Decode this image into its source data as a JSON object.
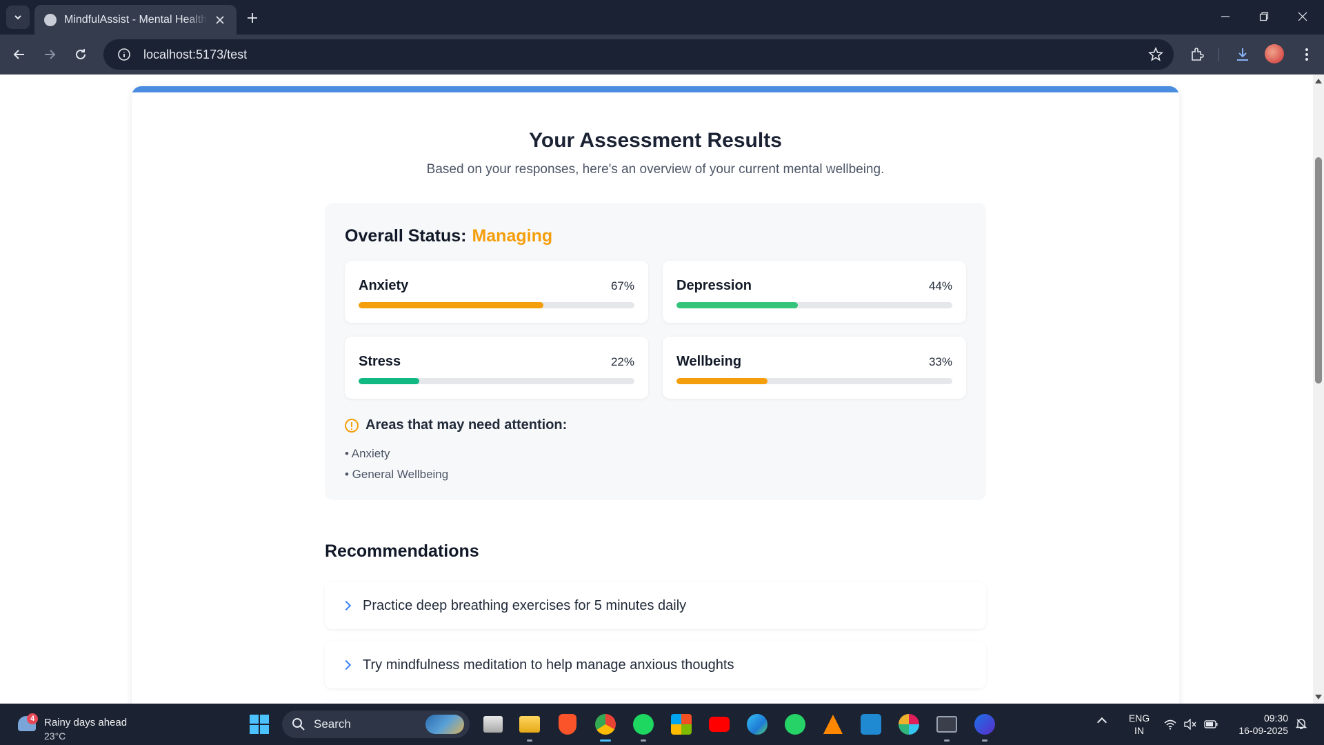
{
  "browser": {
    "tab_title": "MindfulAssist - Mental Health Assistant",
    "url": "localhost:5173/test"
  },
  "page": {
    "title": "Your Assessment Results",
    "subtitle": "Based on your responses, here's an overview of your current mental wellbeing.",
    "status": {
      "label": "Overall Status:",
      "value": "Managing",
      "value_color": "#f59e0b"
    },
    "metrics": [
      {
        "name": "Anxiety",
        "percent_label": "67%",
        "percent": 67,
        "color": "#f59e0b"
      },
      {
        "name": "Depression",
        "percent_label": "44%",
        "percent": 44,
        "color": "#34c47a"
      },
      {
        "name": "Stress",
        "percent_label": "22%",
        "percent": 22,
        "color": "#10b981"
      },
      {
        "name": "Wellbeing",
        "percent_label": "33%",
        "percent": 33,
        "color": "#f59e0b"
      }
    ],
    "attention": {
      "title": "Areas that may need attention:",
      "items": [
        "• Anxiety",
        "• General Wellbeing"
      ]
    },
    "recommendations": {
      "title": "Recommendations",
      "items": [
        "Practice deep breathing exercises for 5 minutes daily",
        "Try mindfulness meditation to help manage anxious thoughts"
      ]
    }
  },
  "taskbar": {
    "weather_title": "Rainy days ahead",
    "weather_temp": "23°C",
    "weather_badge": "4",
    "search_label": "Search",
    "apps": [
      "file-explorer-icon",
      "folder-icon",
      "brave-icon",
      "chrome-icon",
      "spotify-icon",
      "store-icon",
      "youtube-icon",
      "edge-icon",
      "whatsapp-icon",
      "vlc-icon",
      "vscode-icon",
      "slack-icon",
      "terminal-icon",
      "webex-icon"
    ],
    "lang_line1": "ENG",
    "lang_line2": "IN",
    "time": "09:30",
    "date": "16-09-2025"
  }
}
